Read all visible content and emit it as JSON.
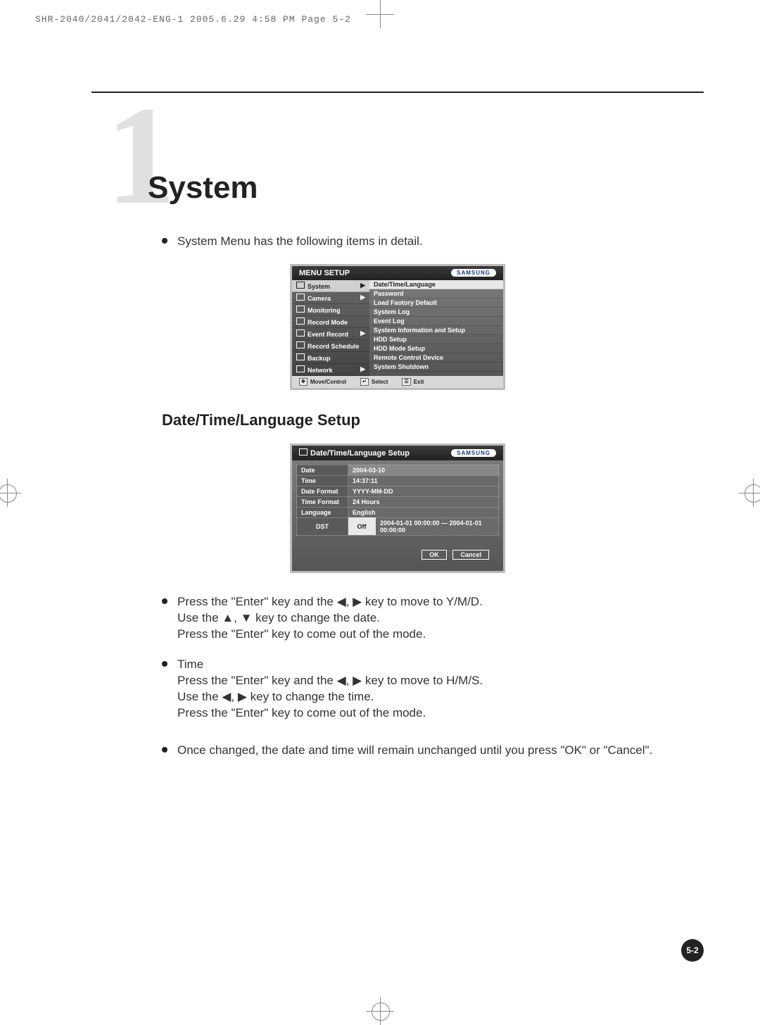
{
  "header": "SHR-2040/2041/2042-ENG-1  2005.6.29  4:58 PM  Page 5-2",
  "chapter": {
    "number": "1",
    "title": "System"
  },
  "intro_bullet": "System Menu has the following items in detail.",
  "menu_screenshot": {
    "title": "MENU SETUP",
    "brand": "SAMSUNG",
    "left_items": [
      {
        "label": "System",
        "selected": true,
        "arrow": true
      },
      {
        "label": "Camera",
        "selected": false,
        "arrow": true
      },
      {
        "label": "Monitoring",
        "selected": false,
        "arrow": false
      },
      {
        "label": "Record Mode",
        "selected": false,
        "arrow": false
      },
      {
        "label": "Event Record",
        "selected": false,
        "arrow": true
      },
      {
        "label": "Record Schedule",
        "selected": false,
        "arrow": false
      },
      {
        "label": "Backup",
        "selected": false,
        "arrow": false
      },
      {
        "label": "Network",
        "selected": false,
        "arrow": true
      }
    ],
    "right_items": [
      {
        "label": "Date/Time/Language",
        "selected": true
      },
      {
        "label": "Password"
      },
      {
        "label": "Load Faotory Default"
      },
      {
        "label": "System Log"
      },
      {
        "label": "Event Log"
      },
      {
        "label": "System Information and Setup"
      },
      {
        "label": "HDD Setup"
      },
      {
        "label": "HDD Mode Setup"
      },
      {
        "label": "Remote Control Device"
      },
      {
        "label": "System Shutdown"
      }
    ],
    "footer": {
      "move": "Move/Control",
      "select": "Select",
      "exit": "Exit"
    }
  },
  "section_heading": "Date/Time/Language Setup",
  "dt_screenshot": {
    "title": "Date/Time/Language Setup",
    "brand": "SAMSUNG",
    "rows": [
      {
        "label": "Date",
        "value": "2004-03-10",
        "hl": true
      },
      {
        "label": "Time",
        "value": "14:37:11"
      },
      {
        "label": "Date Format",
        "value": "YYYY-MM-DD"
      },
      {
        "label": "Time Format",
        "value": "24 Hours"
      },
      {
        "label": "Language",
        "value": "English"
      }
    ],
    "dst": {
      "label": "DST",
      "state": "Off",
      "range": "2004-01-01 00:00:00  —  2004-01-01 00:00:00"
    },
    "ok": "OK",
    "cancel": "Cancel"
  },
  "instructions": {
    "block1_l1": "Press the \"Enter\" key and the ◀, ▶ key to move to Y/M/D.",
    "block1_l2": "Use the ▲, ▼ key to change the date.",
    "block1_l3": "Press the \"Enter\" key to come out of the mode.",
    "block2_head": "Time",
    "block2_l1": "Press the \"Enter\" key and the ◀, ▶ key to move to H/M/S.",
    "block2_l2": "Use the ◀, ▶ key to change the time.",
    "block2_l3": "Press the \"Enter\" key to come out of the mode.",
    "block3": "Once changed, the date and time will remain unchanged until you press \"OK\" or \"Cancel\"."
  },
  "page_number": "5-2"
}
